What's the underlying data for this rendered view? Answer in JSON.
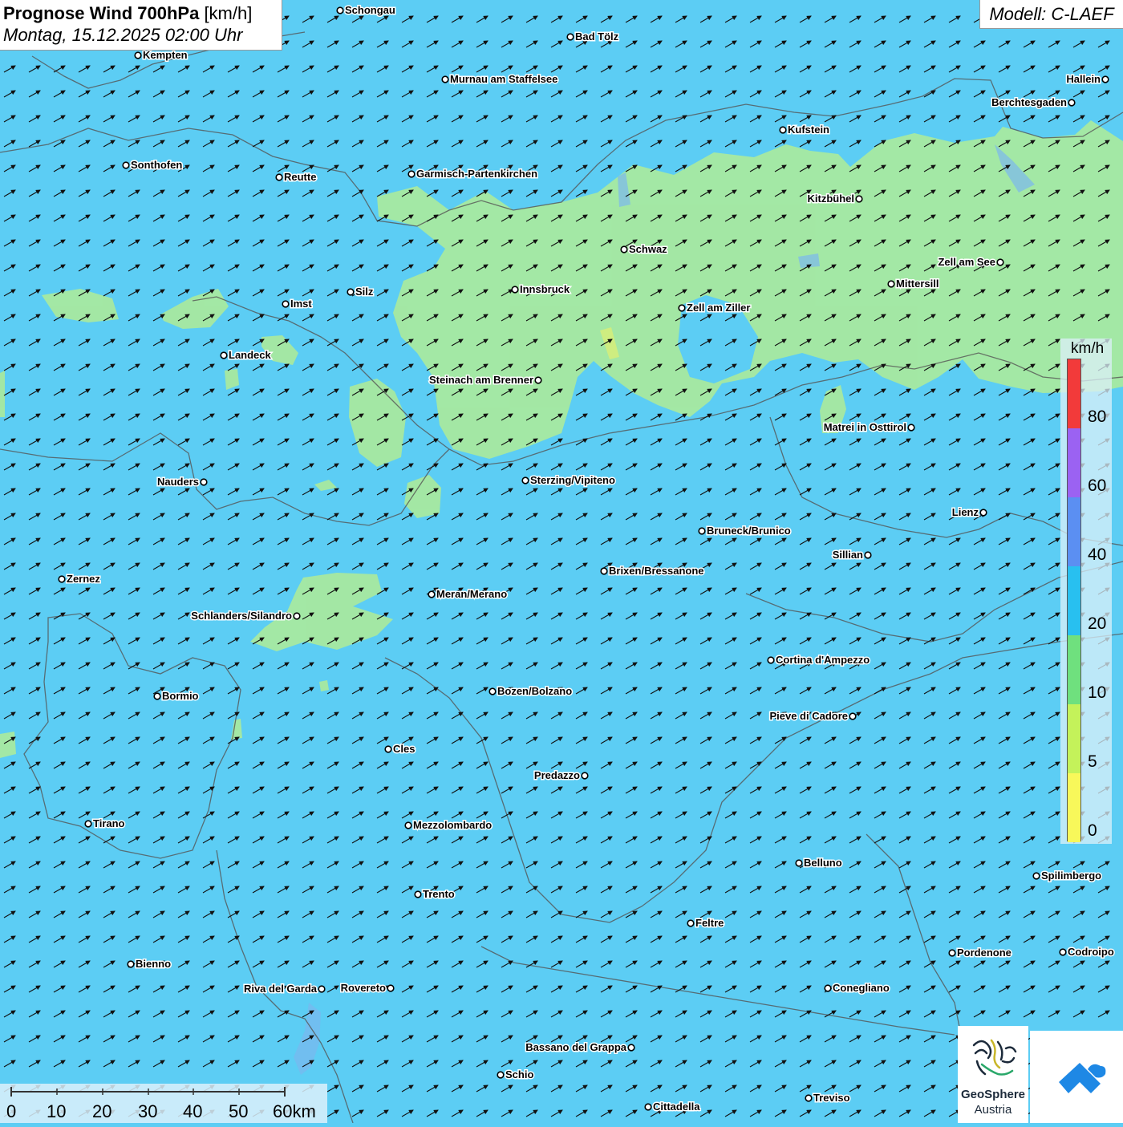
{
  "title": {
    "main": "Prognose Wind 700hPa",
    "unit": "[km/h]",
    "datetime": "Montag, 15.12.2025 02:00 Uhr"
  },
  "model": "Modell: C-LAEF",
  "legend": {
    "unit": "km/h",
    "ticks": [
      "80",
      "60",
      "40",
      "20",
      "10",
      "5",
      "0"
    ],
    "colors": [
      "#f23a3a",
      "#9b62f2",
      "#5b8ff2",
      "#28c0f0",
      "#6fe07e",
      "#c4f25a",
      "#f8f85a"
    ]
  },
  "scale_bar": {
    "labels": [
      "0",
      "10",
      "20",
      "30",
      "40",
      "50",
      "60km"
    ]
  },
  "logos": {
    "geosphere_line1": "GeoSphere",
    "geosphere_line2": "Austria",
    "icons": [
      "geosphere-logo-icon",
      "app-logo-icon"
    ]
  },
  "wind": {
    "predominant_direction": "from southwest",
    "field_color": "#5ccdf4",
    "calm_area_color": "#a7e9a0"
  },
  "cities": [
    {
      "name": "Schongau"
    },
    {
      "name": "Bad Tölz"
    },
    {
      "name": "Kempten"
    },
    {
      "name": "Murnau am Staffelsee"
    },
    {
      "name": "Hallein"
    },
    {
      "name": "Berchtesgaden"
    },
    {
      "name": "Kufstein"
    },
    {
      "name": "Sonthofen"
    },
    {
      "name": "Reutte"
    },
    {
      "name": "Garmisch-Partenkirchen"
    },
    {
      "name": "Kitzbühel"
    },
    {
      "name": "Schwaz"
    },
    {
      "name": "Zell am See"
    },
    {
      "name": "Mittersill"
    },
    {
      "name": "Innsbruck"
    },
    {
      "name": "Imst"
    },
    {
      "name": "Silz"
    },
    {
      "name": "Zell am Ziller"
    },
    {
      "name": "Landeck"
    },
    {
      "name": "Steinach am Brenner"
    },
    {
      "name": "Matrei in Osttirol"
    },
    {
      "name": "Nauders"
    },
    {
      "name": "Sterzing/Vipiteno"
    },
    {
      "name": "Lienz"
    },
    {
      "name": "Bruneck/Brunico"
    },
    {
      "name": "Sillian"
    },
    {
      "name": "Zernez"
    },
    {
      "name": "Brixen/Bressanone"
    },
    {
      "name": "Meran/Merano"
    },
    {
      "name": "Schlanders/Silandro"
    },
    {
      "name": "Cortina d'Ampezzo"
    },
    {
      "name": "Bozen/Bolzano"
    },
    {
      "name": "Bormio"
    },
    {
      "name": "Pieve di Cadore"
    },
    {
      "name": "Cles"
    },
    {
      "name": "Predazzo"
    },
    {
      "name": "Tirano"
    },
    {
      "name": "Mezzolombardo"
    },
    {
      "name": "Belluno"
    },
    {
      "name": "Spilimbergo"
    },
    {
      "name": "Trento"
    },
    {
      "name": "Feltre"
    },
    {
      "name": "Bienno"
    },
    {
      "name": "Pordenone"
    },
    {
      "name": "Codroipo"
    },
    {
      "name": "Riva del Garda"
    },
    {
      "name": "Rovereto"
    },
    {
      "name": "Conegliano"
    },
    {
      "name": "Bassano del Grappa"
    },
    {
      "name": "Schio"
    },
    {
      "name": "Treviso"
    },
    {
      "name": "Cittadella"
    }
  ]
}
